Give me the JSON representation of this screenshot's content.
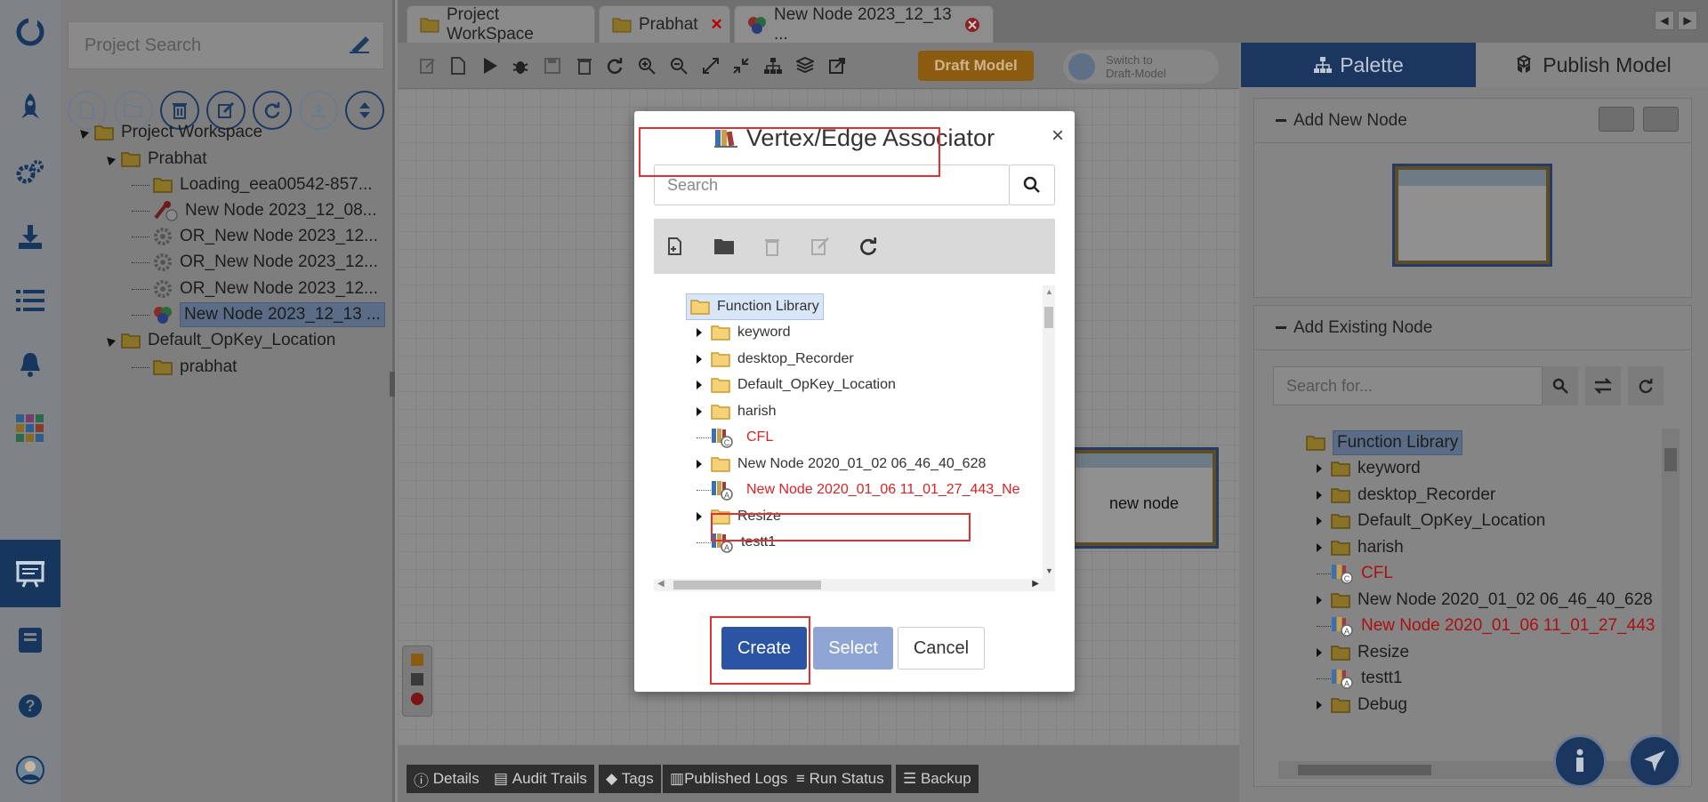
{
  "left_rail": {
    "icons": [
      "logo-icon",
      "rocket-icon",
      "settings-icon",
      "download-icon",
      "list-icon",
      "bell-icon",
      "grid-icon",
      "presentation-icon",
      "book-icon",
      "help-icon",
      "avatar"
    ]
  },
  "project_panel": {
    "search_placeholder": "Project Search",
    "tree": [
      {
        "label": "Project Workspace",
        "level": 0,
        "icon": "folder"
      },
      {
        "label": "Prabhat",
        "level": 1,
        "icon": "folder"
      },
      {
        "label": "Loading_eea00542-857...",
        "level": 2,
        "icon": "folder"
      },
      {
        "label": "New Node 2023_12_08...",
        "level": 2,
        "icon": "tool"
      },
      {
        "label": "OR_New Node 2023_12...",
        "level": 2,
        "icon": "gear"
      },
      {
        "label": "OR_New Node 2023_12...",
        "level": 2,
        "icon": "gear"
      },
      {
        "label": "OR_New Node 2023_12...",
        "level": 2,
        "icon": "gear"
      },
      {
        "label": "New Node 2023_12_13 ...",
        "level": 2,
        "icon": "node",
        "selected": true
      },
      {
        "label": "Default_OpKey_Location",
        "level": 1,
        "icon": "folder"
      },
      {
        "label": "prabhat",
        "level": 2,
        "icon": "folder"
      }
    ]
  },
  "tabs": [
    {
      "label": "Project WorkSpace"
    },
    {
      "label": "Prabhat"
    },
    {
      "label": "New Node 2023_12_13 ..."
    }
  ],
  "canvas_toolbar": {
    "draft_button": "Draft Model",
    "switch_label_1": "Switch to",
    "switch_label_2": "Draft-Model"
  },
  "canvas": {
    "node_label": "new node"
  },
  "bottom_tabs": [
    "Details",
    "Audit Trails",
    "Tags",
    "Published Logs",
    "Run Status",
    "Backup"
  ],
  "right_panel": {
    "palette_tab": "Palette",
    "publish_tab": "Publish Model",
    "add_new_node": "Add New Node",
    "add_existing_node": "Add Existing Node",
    "search_placeholder": "Search for...",
    "tree": [
      {
        "label": "Function Library",
        "type": "root"
      },
      {
        "label": "keyword",
        "type": "folder"
      },
      {
        "label": "desktop_Recorder",
        "type": "folder"
      },
      {
        "label": "Default_OpKey_Location",
        "type": "folder"
      },
      {
        "label": "harish",
        "type": "folder"
      },
      {
        "label": "CFL",
        "type": "item",
        "red": true
      },
      {
        "label": "New Node 2020_01_02 06_46_40_628",
        "type": "folder"
      },
      {
        "label": "New Node 2020_01_06 11_01_27_443",
        "type": "item",
        "red": true
      },
      {
        "label": "Resize",
        "type": "folder"
      },
      {
        "label": "testt1",
        "type": "item"
      },
      {
        "label": "Debug",
        "type": "folder"
      }
    ]
  },
  "modal": {
    "title": "Vertex/Edge Associator",
    "close": "×",
    "search_placeholder": "Search",
    "tree": [
      {
        "label": "Function Library",
        "type": "root"
      },
      {
        "label": "keyword",
        "type": "folder"
      },
      {
        "label": "desktop_Recorder",
        "type": "folder"
      },
      {
        "label": "Default_OpKey_Location",
        "type": "folder"
      },
      {
        "label": "harish",
        "type": "folder"
      },
      {
        "label": "CFL",
        "type": "item",
        "red": true
      },
      {
        "label": "New Node 2020_01_02 06_46_40_628",
        "type": "folder"
      },
      {
        "label": "New Node 2020_01_06 11_01_27_443_Ne",
        "type": "item",
        "red": true
      },
      {
        "label": "Resize",
        "type": "folder"
      },
      {
        "label": "testt1",
        "type": "item"
      }
    ],
    "buttons": {
      "create": "Create",
      "select": "Select",
      "cancel": "Cancel"
    }
  },
  "colors": {
    "accent_navy": "#2b54a4",
    "draft_orange": "#e8a02a",
    "highlight_red": "#e03030",
    "tree_red": "#d22222"
  }
}
